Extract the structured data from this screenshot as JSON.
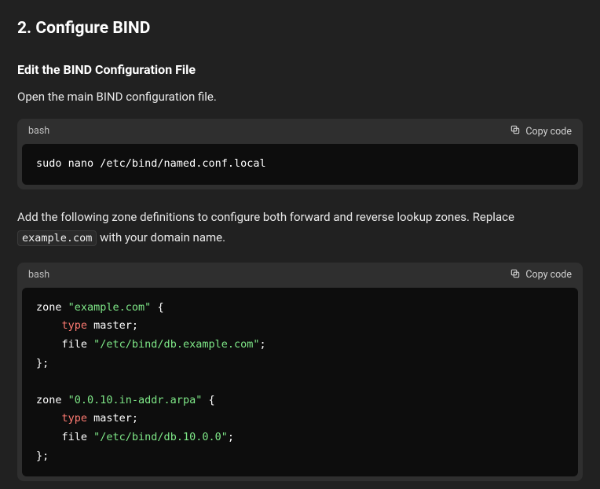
{
  "heading": "2. Configure BIND",
  "subheading": "Edit the BIND Configuration File",
  "intro": "Open the main BIND configuration file.",
  "paragraph2_a": "Add the following zone definitions to configure both forward and reverse lookup zones. Replace ",
  "paragraph2_code": "example.com",
  "paragraph2_b": " with your domain name.",
  "copy_label": "Copy code",
  "code1": {
    "lang": "bash",
    "tokens": [
      [
        {
          "t": "sudo nano /etc/bind/named.conf.local",
          "c": "tk-plain"
        }
      ]
    ]
  },
  "code2": {
    "lang": "bash",
    "tokens": [
      [
        {
          "t": "zone ",
          "c": "tk-plain"
        },
        {
          "t": "\"example.com\"",
          "c": "tk-str"
        },
        {
          "t": " {",
          "c": "tk-plain"
        }
      ],
      [
        {
          "t": "    ",
          "c": "tk-plain"
        },
        {
          "t": "type",
          "c": "tk-kw"
        },
        {
          "t": " master;",
          "c": "tk-plain"
        }
      ],
      [
        {
          "t": "    file ",
          "c": "tk-plain"
        },
        {
          "t": "\"/etc/bind/db.example.com\"",
          "c": "tk-str"
        },
        {
          "t": ";",
          "c": "tk-plain"
        }
      ],
      [
        {
          "t": "};",
          "c": "tk-plain"
        }
      ],
      [],
      [
        {
          "t": "zone ",
          "c": "tk-plain"
        },
        {
          "t": "\"0.0.10.in-addr.arpa\"",
          "c": "tk-str"
        },
        {
          "t": " {",
          "c": "tk-plain"
        }
      ],
      [
        {
          "t": "    ",
          "c": "tk-plain"
        },
        {
          "t": "type",
          "c": "tk-kw"
        },
        {
          "t": " master;",
          "c": "tk-plain"
        }
      ],
      [
        {
          "t": "    file ",
          "c": "tk-plain"
        },
        {
          "t": "\"/etc/bind/db.10.0.0\"",
          "c": "tk-str"
        },
        {
          "t": ";",
          "c": "tk-plain"
        }
      ],
      [
        {
          "t": "};",
          "c": "tk-plain"
        }
      ]
    ]
  }
}
